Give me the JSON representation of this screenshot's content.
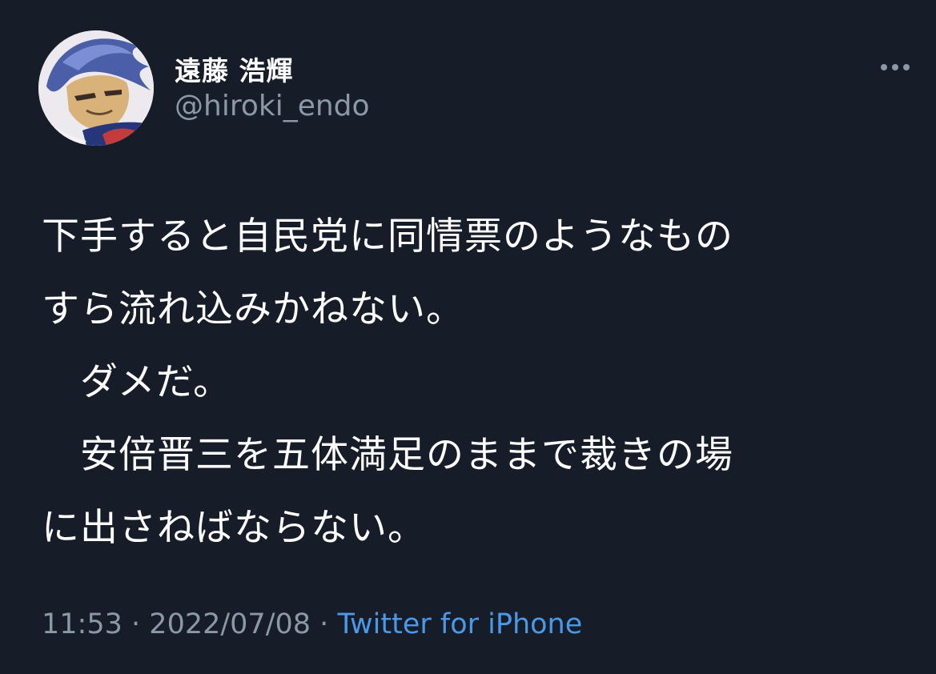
{
  "author": {
    "display_name": "遠藤 浩輝",
    "handle": "@hiroki_endo"
  },
  "tweet": {
    "lines": [
      "下手すると自民党に同情票のようなもの",
      "すら流れ込みかねない。",
      "　ダメだ。",
      "　安倍晋三を五体満足のままで裁きの場",
      "に出さねばならない。"
    ],
    "time": "11:53",
    "date": "2022/07/08",
    "separator": "·",
    "source": "Twitter for iPhone"
  },
  "icons": {
    "more": "more-horizontal-icon",
    "avatar": "avatar"
  },
  "colors": {
    "background": "#161c28",
    "text": "#ffffff",
    "secondary": "#8b98a5",
    "link": "#4a99e9"
  }
}
